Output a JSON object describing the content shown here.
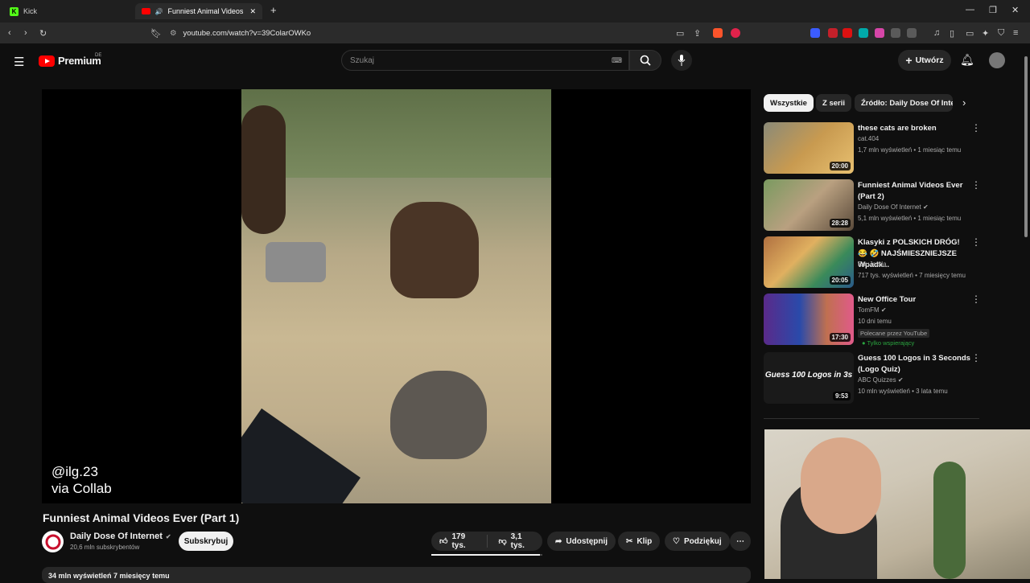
{
  "browser": {
    "tabs": [
      {
        "label": "Kick",
        "active": false
      },
      {
        "label": "Funniest Animal Videos Ever (Part",
        "active": true
      }
    ],
    "new_tab": "+",
    "url": "youtube.com/watch?v=39ColarOWKo",
    "window_controls": [
      "—",
      "❐",
      "✕"
    ]
  },
  "header": {
    "logo_text": "Premium",
    "logo_region": "DE",
    "search_placeholder": "Szukaj",
    "create_label": "Utwórz"
  },
  "video": {
    "overlay_line1": "@ilg.23",
    "overlay_line2": "via Collab",
    "title": "Funniest Animal Videos Ever (Part 1)",
    "channel": "Daily Dose Of Internet",
    "subscribers": "20,6 mln subskrybentów",
    "subscribe_label": "Subskrybuj",
    "likes": "179 tys.",
    "dislikes": "3,1 tys.",
    "share_label": "Udostępnij",
    "clip_label": "Klip",
    "thanks_label": "Podziękuj",
    "description_stats": "34 mln wyświetleń  7 miesięcy temu"
  },
  "chips": [
    "Wszystkie",
    "Z serii",
    "Źródło: Daily Dose Of Internet"
  ],
  "related": [
    {
      "title": "these cats are broken",
      "channel": "cat.404",
      "meta": "1,7 mln wyświetleń • 1 miesiąc temu",
      "duration": "20:00",
      "verified": false
    },
    {
      "title": "Funniest Animal Videos Ever (Part 2)",
      "channel": "Daily Dose Of Internet",
      "meta": "5,1 mln wyświetleń • 1 miesiąc temu",
      "duration": "28:28",
      "verified": true
    },
    {
      "title": "Klasyki z POLSKICH DRÓG! 😂 🤣 NAJŚMIESZNIEJSZE Wpadk...",
      "channel": "EduJazda",
      "meta": "717 tys. wyświetleń • 7 miesięcy temu",
      "duration": "20:05",
      "verified": false
    },
    {
      "title": "New Office Tour",
      "channel": "TomFM",
      "meta": "10 dni temu",
      "duration": "17:30",
      "verified": true,
      "badge": "Polecane przez YouTube",
      "green_badge": "Tylko wspierający"
    },
    {
      "title": "Guess 100 Logos in 3 Seconds (Logo Quiz)",
      "channel": "ABC Quizzes",
      "meta": "10 mln wyświetleń • 3 lata temu",
      "duration": "9:53",
      "verified": true,
      "thumb_text": "Guess 100 Logos in 3s"
    }
  ],
  "colors": {
    "brand": "#ff0000",
    "background": "#0f0f0f",
    "surface": "#272727",
    "green": "#2ba640"
  }
}
